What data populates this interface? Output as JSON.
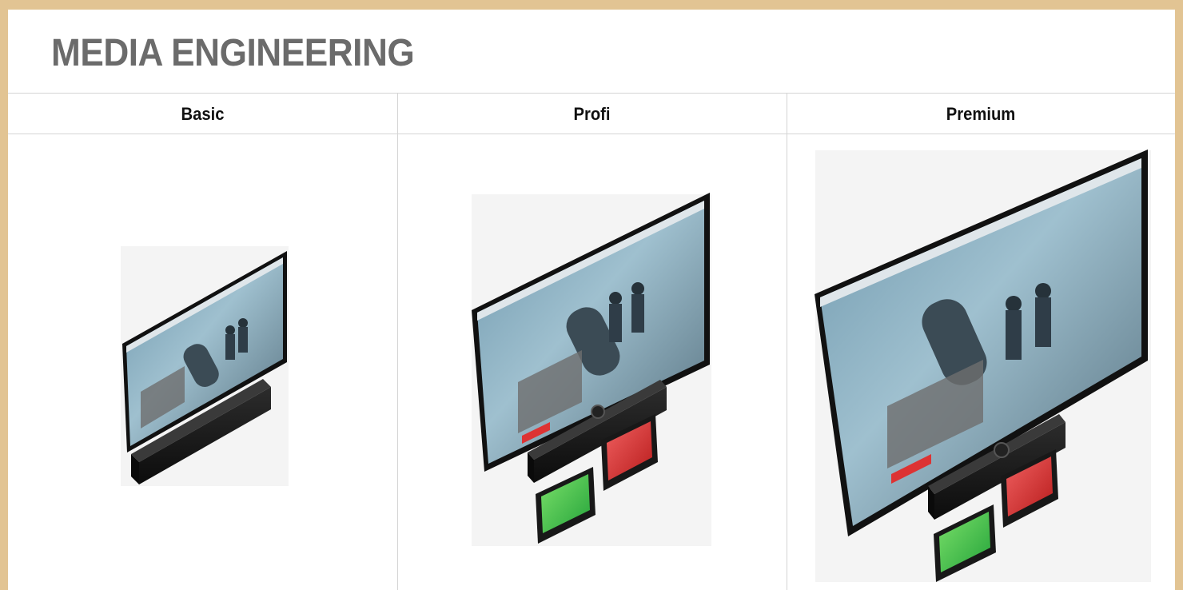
{
  "document": {
    "title": "MEDIA ENGINEERING",
    "columns": [
      {
        "label": "Basic"
      },
      {
        "label": "Profi"
      },
      {
        "label": "Premium"
      }
    ]
  },
  "colors": {
    "frame": "#e2c493",
    "title": "#6b6b6b",
    "divider": "#d4d4d4"
  }
}
